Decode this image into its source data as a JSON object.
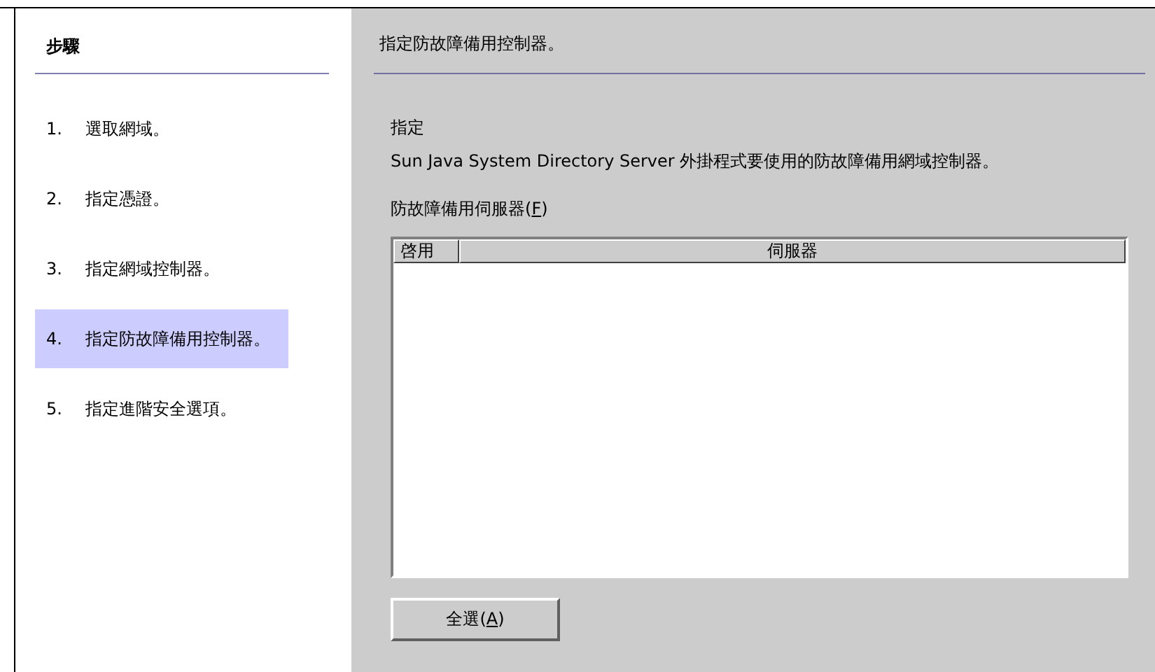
{
  "steps": {
    "title": "步驟",
    "items": [
      {
        "number": "1.",
        "label": "選取網域。",
        "selected": false
      },
      {
        "number": "2.",
        "label": "指定憑證。",
        "selected": false
      },
      {
        "number": "3.",
        "label": "指定網域控制器。",
        "selected": false
      },
      {
        "number": "4.",
        "label": "指定防故障備用控制器。",
        "selected": true
      },
      {
        "number": "5.",
        "label": "指定進階安全選項。",
        "selected": false
      }
    ]
  },
  "panel": {
    "title": "指定防故障備用控制器。",
    "heading": "指定",
    "description": "Sun Java System Directory Server 外掛程式要使用的防故障備用網域控制器。",
    "list_label": {
      "before": "防故障備用伺服器(",
      "mnemonic": "F",
      "after": ")"
    },
    "table": {
      "columns": [
        "啓用",
        "伺服器"
      ]
    },
    "button": {
      "before": "全選(",
      "mnemonic": "A",
      "after": ")"
    }
  }
}
